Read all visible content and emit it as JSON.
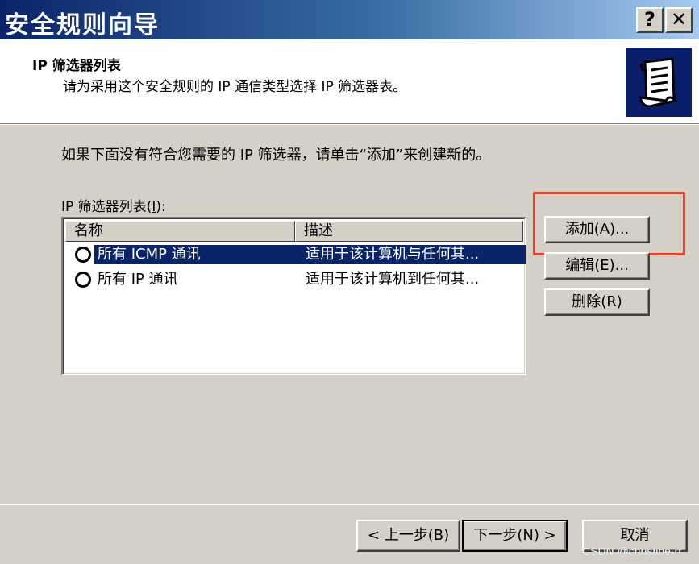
{
  "window": {
    "title": "安全规则向导",
    "help_label": "?",
    "close_label": "✕"
  },
  "header": {
    "title": "IP 筛选器列表",
    "subtitle": "请为采用这个安全规则的 IP 通信类型选择 IP 筛选器表。",
    "icon": "scroll-icon"
  },
  "main": {
    "instruction": "如果下面没有符合您需要的 IP 筛选器，请单击“添加”来创建新的。",
    "list_label_prefix": "IP 筛选器列表(",
    "list_label_key": "I",
    "list_label_suffix": "):",
    "columns": [
      "名称",
      "描述"
    ],
    "rows": [
      {
        "name": "所有 ICMP 通讯",
        "description": "适用于该计算机与任何其...",
        "selected": true
      },
      {
        "name": "所有 IP 通讯",
        "description": "适用于该计算机到任何其...",
        "selected": false
      }
    ]
  },
  "side_buttons": {
    "add": "添加(A)...",
    "edit": "编辑(E)...",
    "delete": "删除(R)"
  },
  "footer": {
    "back": "< 上一步(B)",
    "next": "下一步(N) >",
    "cancel": "取消"
  },
  "watermark": "CSDN @christine-rr",
  "colors": {
    "title_gradient_start": "#0a246a",
    "title_gradient_end": "#a6caf0",
    "selection": "#0a246a",
    "highlight_box": "#f43b24",
    "dialog_bg": "#d4d0c8"
  }
}
